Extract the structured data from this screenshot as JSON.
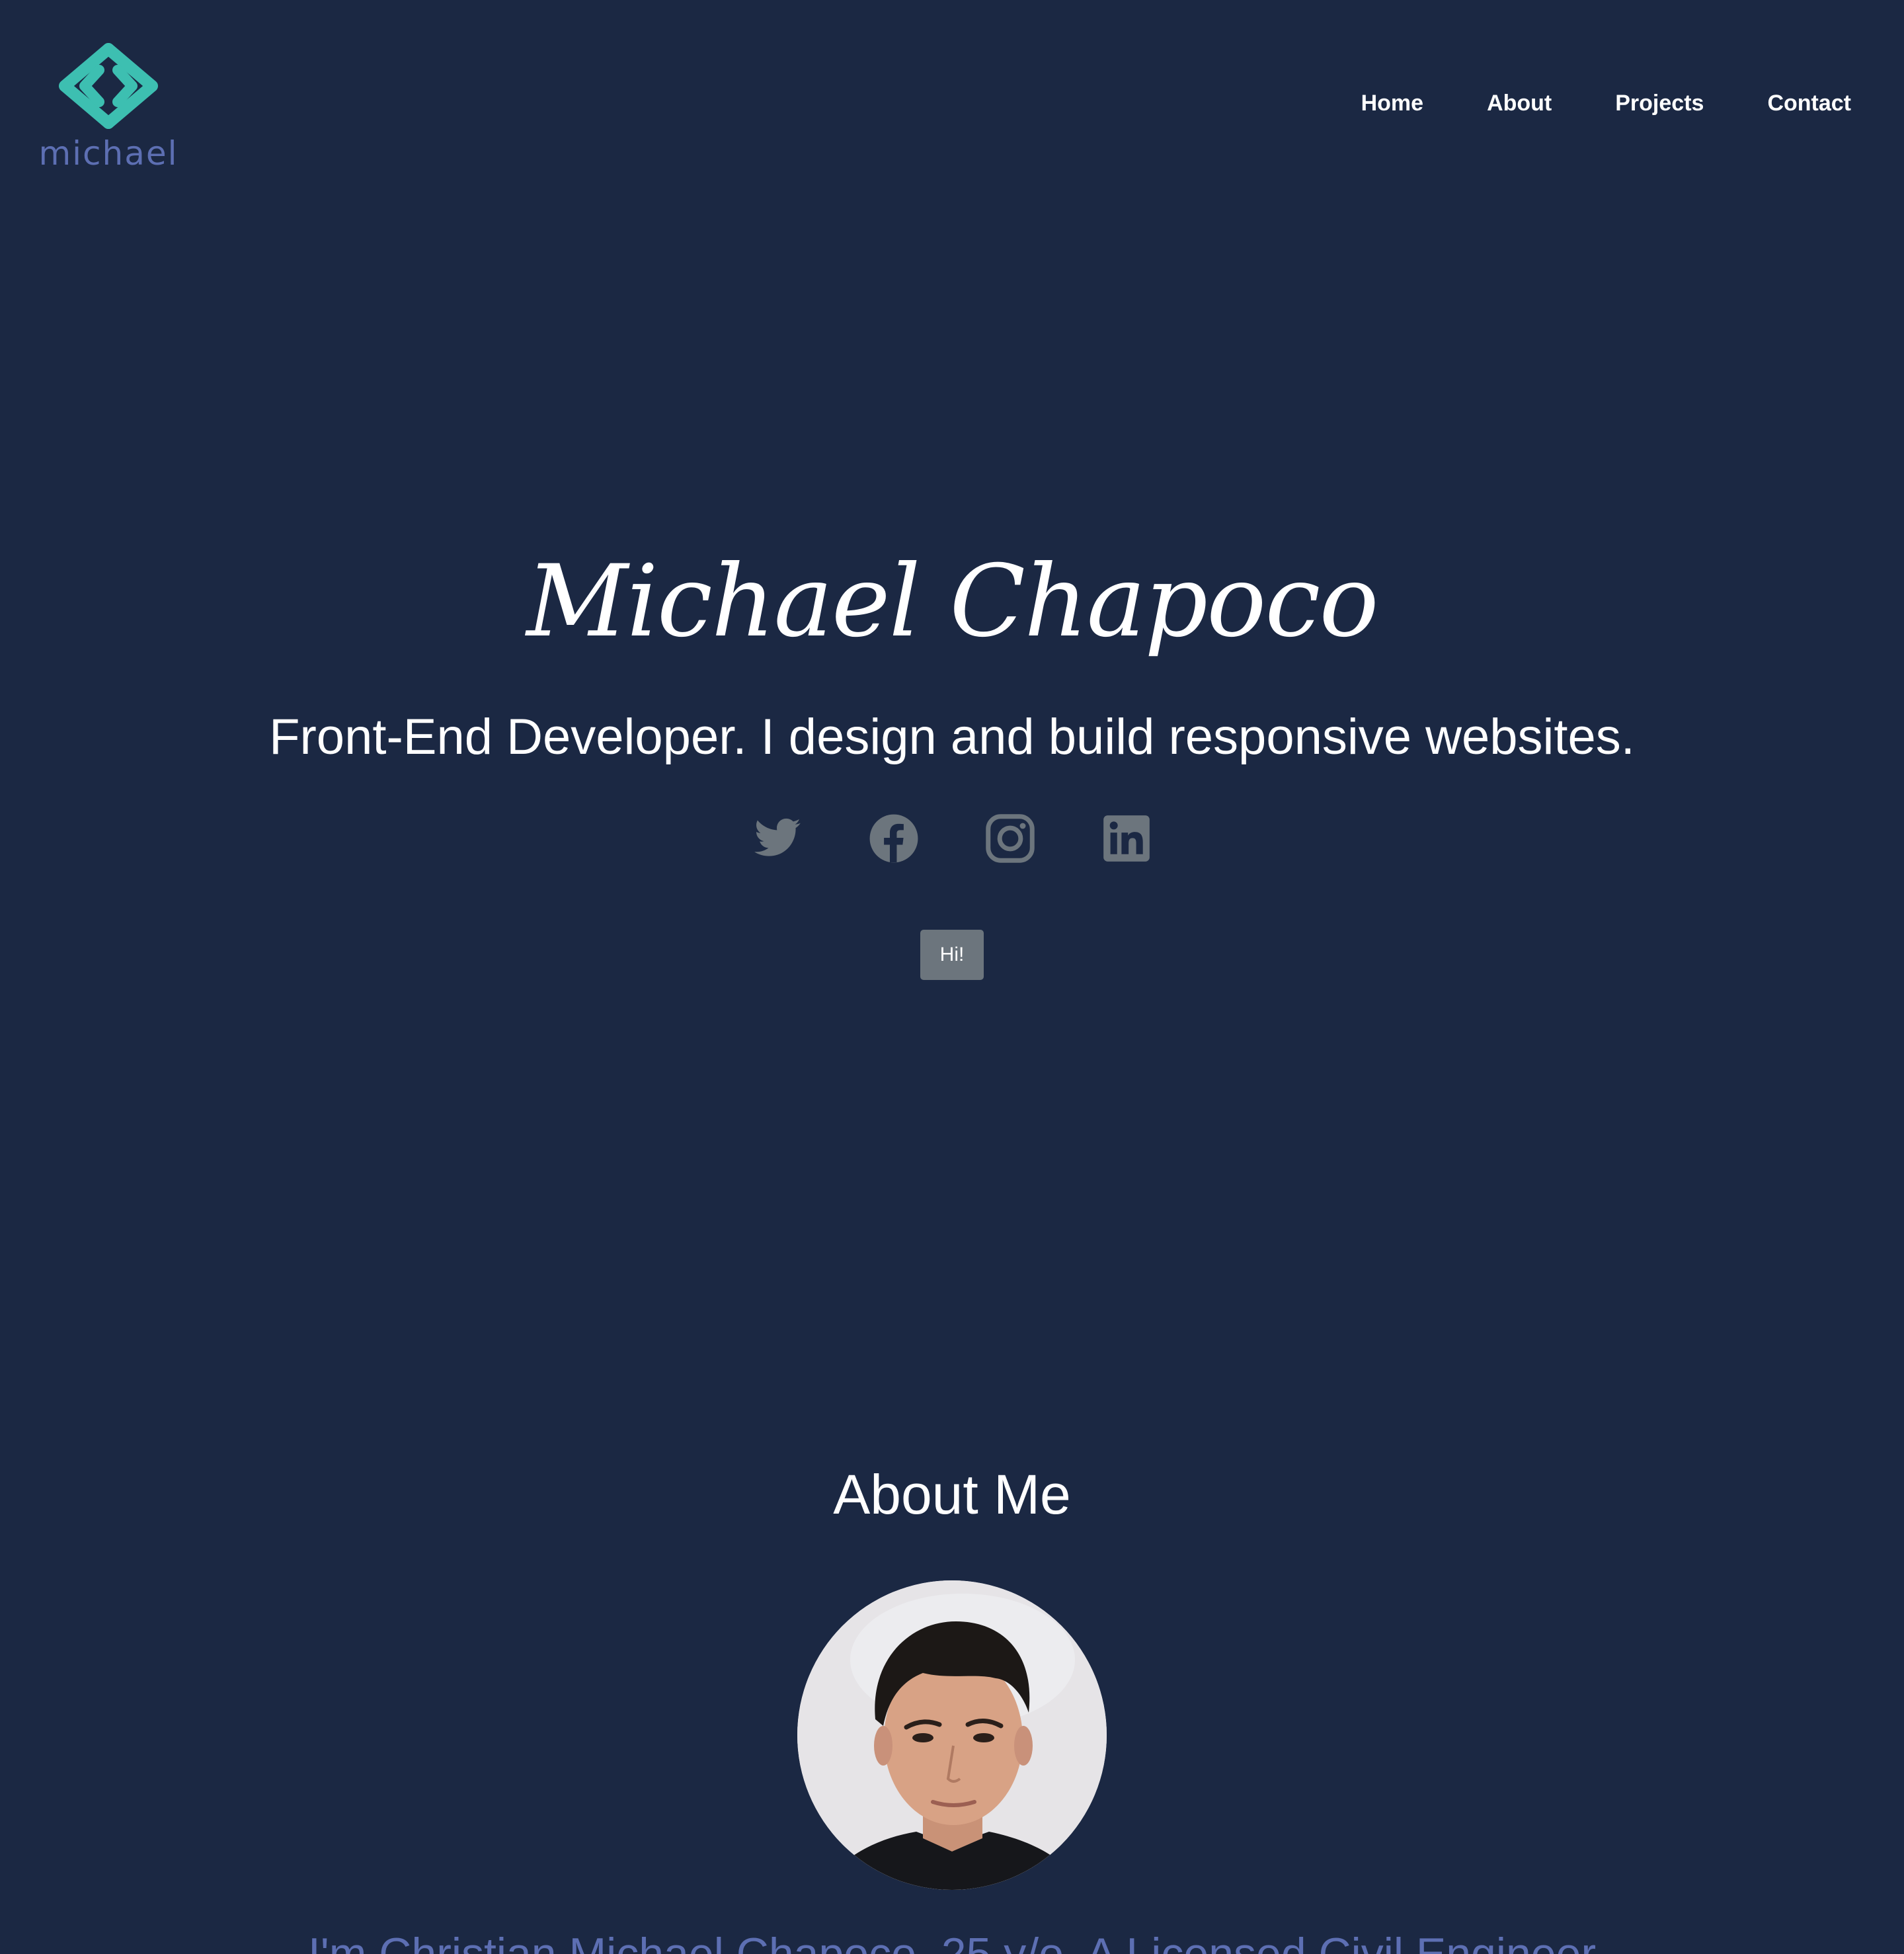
{
  "header": {
    "logo_text": "michael",
    "nav": [
      {
        "label": "Home"
      },
      {
        "label": "About"
      },
      {
        "label": "Projects"
      },
      {
        "label": "Contact"
      }
    ]
  },
  "hero": {
    "name": "Michael Chapoco",
    "tagline": "Front-End Developer. I design and build responsive websites.",
    "socials": [
      {
        "icon": "twitter-icon"
      },
      {
        "icon": "facebook-icon"
      },
      {
        "icon": "instagram-icon"
      },
      {
        "icon": "linkedin-icon"
      }
    ],
    "button_label": "Hi!"
  },
  "about": {
    "title": "About Me",
    "intro": "I'm Christian Michael Chapoco, 25 y/o. A Licensed Civil Engineer"
  },
  "colors": {
    "background": "#1b2843",
    "logo_teal": "#3dbfb1",
    "logo_text": "#5d6fb3",
    "icon_gray": "#6c757d",
    "button_gray": "#6c757d",
    "about_text": "#5d6fb3"
  }
}
